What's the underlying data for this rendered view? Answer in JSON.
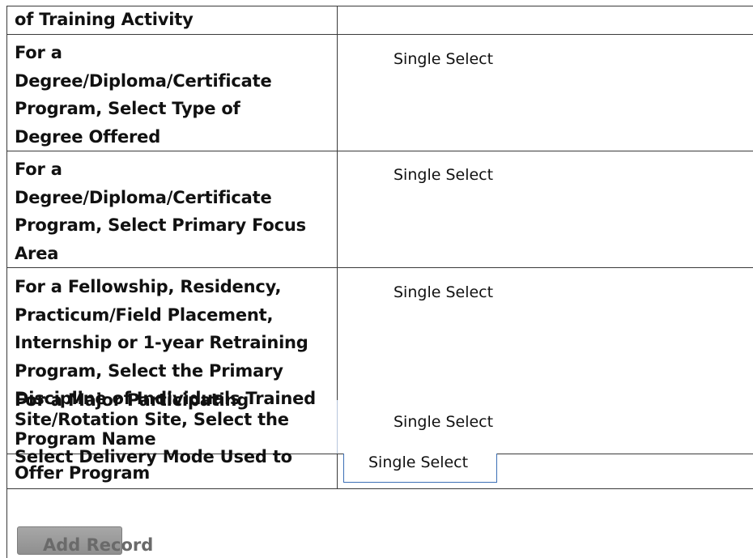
{
  "rows": [
    {
      "label": "of Training Activity",
      "value": ""
    },
    {
      "label": "For a Degree/Diploma/Certificate Program, Select Type of Degree Offered",
      "value": "Single Select"
    },
    {
      "label": "For a Degree/Diploma/Certificate Program, Select Primary Focus Area",
      "value": "Single Select"
    },
    {
      "label": "For a Fellowship, Residency, Practicum/Field Placement, Internship or 1-year Retraining Program, Select the Primary Discipline of Individuals Trained",
      "value": "Single Select"
    },
    {
      "label": "For a Major Participating Site/Rotation Site, Select the Program Name",
      "value": "Single Select"
    },
    {
      "label": "Select Delivery Mode Used to Offer Program",
      "value": "Single Select"
    }
  ],
  "add_record_label": "Add Record"
}
